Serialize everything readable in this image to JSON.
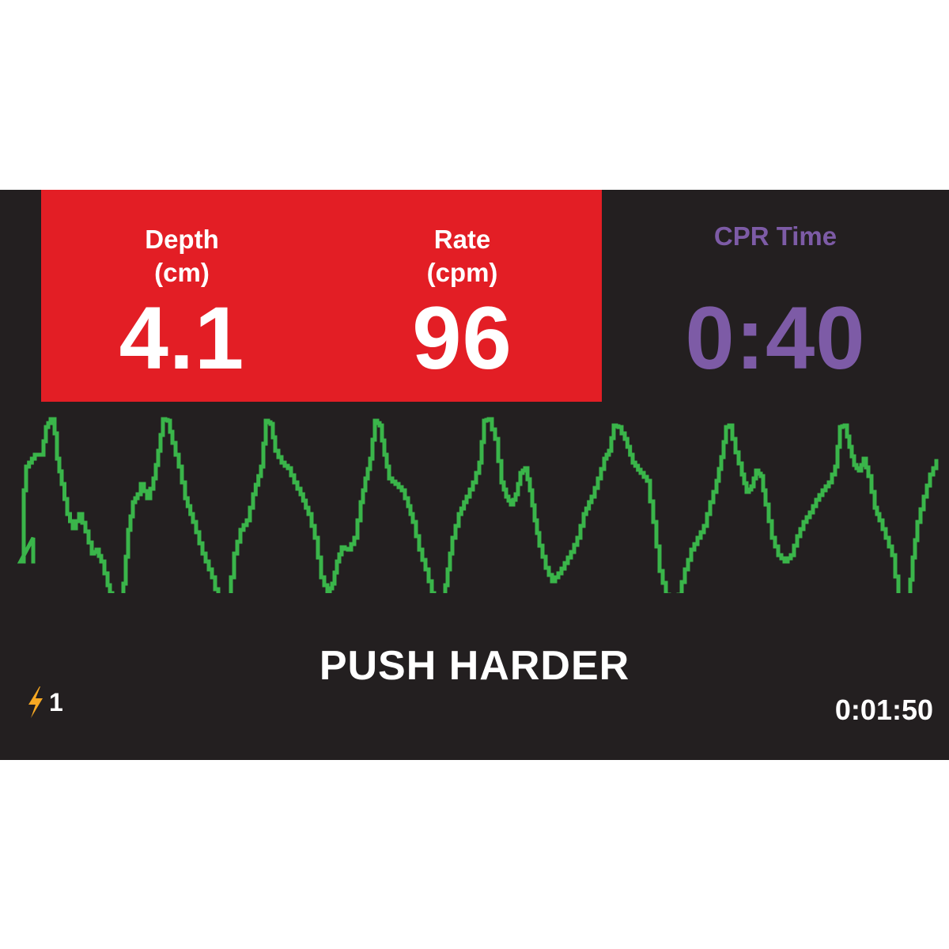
{
  "colors": {
    "background": "#231f20",
    "alert_tile": "#e31e25",
    "cpr_time": "#7d5ba6",
    "waveform": "#3ab54a",
    "text": "#ffffff",
    "shock_icon": "#f7a823"
  },
  "metrics": {
    "depth": {
      "label_line1": "Depth",
      "label_line2": "(cm)",
      "value": "4.1",
      "status": "alert"
    },
    "rate": {
      "label_line1": "Rate",
      "label_line2": "(cpm)",
      "value": "96",
      "status": "alert"
    },
    "cpr_time": {
      "label": "CPR Time",
      "value": "0:40"
    }
  },
  "waveform": {
    "icon": "compression-waveform",
    "color": "#3ab54a"
  },
  "prompt": {
    "message": "PUSH HARDER"
  },
  "shock": {
    "icon": "lightning-bolt-icon",
    "count": "1"
  },
  "elapsed_time": "0:01:50"
}
